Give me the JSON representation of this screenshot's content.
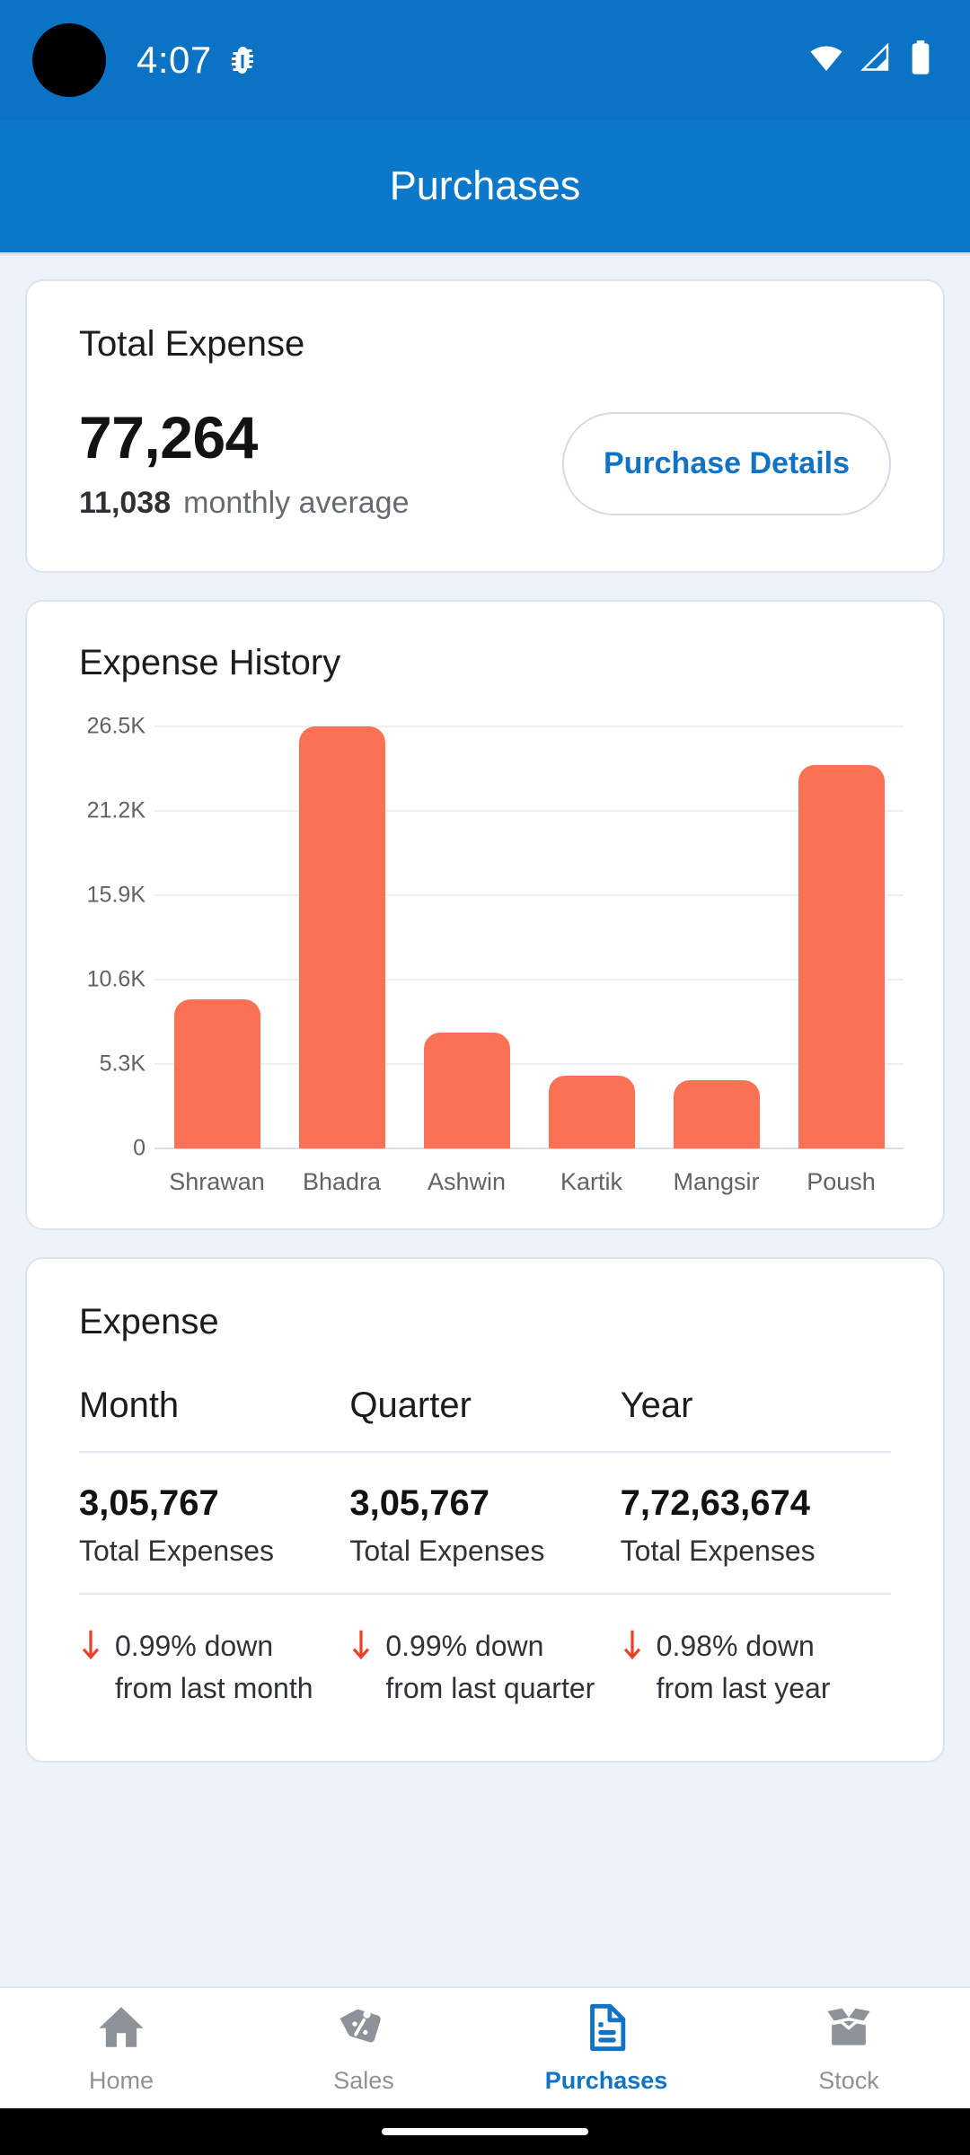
{
  "status_bar": {
    "time": "4:07",
    "icons": [
      "bug-icon",
      "wifi-icon",
      "cellular-signal-icon",
      "battery-icon"
    ]
  },
  "app_bar": {
    "title": "Purchases"
  },
  "total_expense_card": {
    "title": "Total Expense",
    "amount": "77,264",
    "average_value": "11,038",
    "average_label": "monthly average",
    "details_button": "Purchase Details"
  },
  "expense_history_card": {
    "title": "Expense History"
  },
  "chart_data": {
    "type": "bar",
    "title": "Expense History",
    "xlabel": "",
    "ylabel": "",
    "categories": [
      "Shrawan",
      "Bhadra",
      "Ashwin",
      "Kartik",
      "Mangsir",
      "Poush"
    ],
    "values": [
      9400,
      26500,
      7300,
      4600,
      4300,
      24100
    ],
    "tick_labels": [
      "0",
      "5.3K",
      "10.6K",
      "15.9K",
      "21.2K",
      "26.5K"
    ],
    "tick_values": [
      0,
      5300,
      10600,
      15900,
      21200,
      26500
    ],
    "ylim": [
      0,
      26500
    ],
    "grid": true,
    "legend": "none",
    "bar_color": "#fa7254"
  },
  "expense_table_card": {
    "title": "Expense",
    "columns": [
      {
        "header": "Month",
        "value": "3,05,767",
        "caption": "Total Expenses",
        "trend_icon": "arrow-down-icon",
        "trend_line1": "0.99% down",
        "trend_line2": "from last month"
      },
      {
        "header": "Quarter",
        "value": "3,05,767",
        "caption": "Total Expenses",
        "trend_icon": "arrow-down-icon",
        "trend_line1": "0.99% down",
        "trend_line2": "from last quarter"
      },
      {
        "header": "Year",
        "value": "7,72,63,674",
        "caption": "Total Expenses",
        "trend_icon": "arrow-down-icon",
        "trend_line1": "0.98% down",
        "trend_line2": "from last year"
      }
    ]
  },
  "bottom_nav": {
    "items": [
      {
        "label": "Home",
        "icon": "home-icon",
        "active": false
      },
      {
        "label": "Sales",
        "icon": "price-tag-percent-icon",
        "active": false
      },
      {
        "label": "Purchases",
        "icon": "invoice-document-icon",
        "active": true
      },
      {
        "label": "Stock",
        "icon": "open-box-icon",
        "active": false
      }
    ]
  },
  "colors": {
    "app_bar_blue": "#0b78c9",
    "status_bar_blue": "#0b73c4",
    "accent_blue": "#1273c4",
    "bar_orange": "#fa7254",
    "trend_down_red": "#e8432a",
    "page_background": "#eef2fa",
    "inactive_gray": "#8d9299"
  }
}
